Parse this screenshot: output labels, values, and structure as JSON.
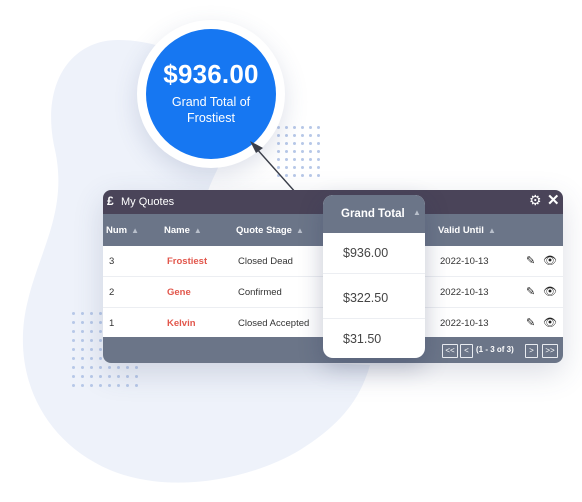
{
  "highlight": {
    "amount": "$936.00",
    "caption": "Grand Total of Frostiest"
  },
  "window": {
    "currency_icon": "£",
    "title": "My Quotes",
    "settings_icon": "gear-icon",
    "close_icon": "close-icon"
  },
  "columns": {
    "num": "Num",
    "name": "Name",
    "stage": "Quote Stage",
    "grand_total": "Grand Total",
    "valid_until": "Valid Until"
  },
  "rows": [
    {
      "num": "3",
      "name": "Frostiest",
      "stage": "Closed Dead",
      "total": "$936.00",
      "valid": "2022-10-13"
    },
    {
      "num": "2",
      "name": "Gene",
      "stage": "Confirmed",
      "total": "$322.50",
      "valid": "2022-10-13"
    },
    {
      "num": "1",
      "name": "Kelvin",
      "stage": "Closed Accepted",
      "total": "$31.50",
      "valid": "2022-10-13"
    }
  ],
  "pagination": {
    "first": "<<",
    "prev": "<",
    "info": "(1 - 3 of 3)",
    "next": ">",
    "last": ">>"
  },
  "colors": {
    "accent_blue": "#1677f2",
    "title_bar": "#4a4459",
    "header_bar": "#6b7588",
    "name_red": "#e2574c"
  }
}
